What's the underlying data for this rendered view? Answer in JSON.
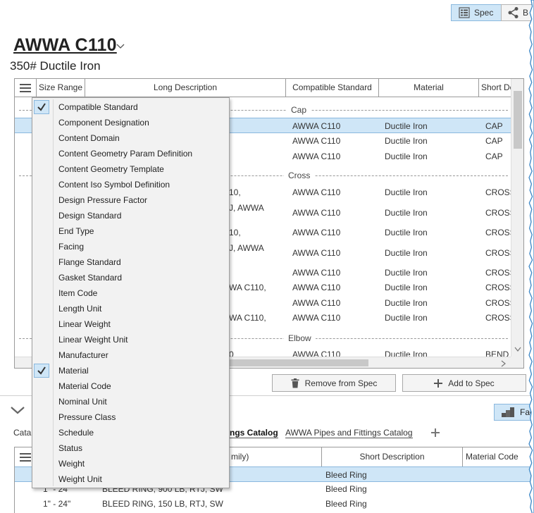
{
  "toolbar": {
    "spec_label": "Spec",
    "share_label": "B"
  },
  "spec": {
    "title": "AWWA C110",
    "subtitle": "350# Ductile Iron"
  },
  "grid": {
    "columns": [
      "Size Range",
      "Long Description",
      "Compatible Standard",
      "Material",
      "Short De"
    ],
    "groups": [
      "Cap",
      "Cross",
      "Elbow"
    ],
    "rows": [
      {
        "long": "",
        "standard": "AWWA C110",
        "material": "Ductile Iron",
        "short": "CAP"
      },
      {
        "long": "",
        "standard": "AWWA C110",
        "material": "Ductile Iron",
        "short": "CAP"
      },
      {
        "long": "",
        "standard": "AWWA C110",
        "material": "Ductile Iron",
        "short": "CAP"
      },
      {
        "long": "10,",
        "standard": "AWWA C110",
        "material": "Ductile Iron",
        "short": "CROSS"
      },
      {
        "long": "J, AWWA",
        "standard": "AWWA C110",
        "material": "Ductile Iron",
        "short": "CROSS"
      },
      {
        "long": "10,",
        "standard": "AWWA C110",
        "material": "Ductile Iron",
        "short": "CROSS"
      },
      {
        "long": "J, AWWA",
        "standard": "AWWA C110",
        "material": "Ductile Iron",
        "short": "CROSS"
      },
      {
        "long": "",
        "standard": "AWWA C110",
        "material": "Ductile Iron",
        "short": "CROSS"
      },
      {
        "long": "WA C110,",
        "standard": "AWWA C110",
        "material": "Ductile Iron",
        "short": "CROSS"
      },
      {
        "long": "",
        "standard": "AWWA C110",
        "material": "Ductile Iron",
        "short": "CROSS"
      },
      {
        "long": "WA C110,",
        "standard": "AWWA C110",
        "material": "Ductile Iron",
        "short": "CROSS"
      },
      {
        "long": "0",
        "standard": "AWWA C110",
        "material": "Ductile Iron",
        "short": "BEND"
      }
    ]
  },
  "column_menu": {
    "items": [
      {
        "label": "Compatible Standard",
        "checked": true
      },
      {
        "label": "Component Designation",
        "checked": false
      },
      {
        "label": "Content Domain",
        "checked": false
      },
      {
        "label": "Content Geometry Param Definition",
        "checked": false
      },
      {
        "label": "Content Geometry Template",
        "checked": false
      },
      {
        "label": "Content Iso Symbol Definition",
        "checked": false
      },
      {
        "label": "Design Pressure Factor",
        "checked": false
      },
      {
        "label": "Design Standard",
        "checked": false
      },
      {
        "label": "End Type",
        "checked": false
      },
      {
        "label": "Facing",
        "checked": false
      },
      {
        "label": "Flange Standard",
        "checked": false
      },
      {
        "label": "Gasket Standard",
        "checked": false
      },
      {
        "label": "Item Code",
        "checked": false
      },
      {
        "label": "Length Unit",
        "checked": false
      },
      {
        "label": "Linear Weight",
        "checked": false
      },
      {
        "label": "Linear Weight Unit",
        "checked": false
      },
      {
        "label": "Manufacturer",
        "checked": false
      },
      {
        "label": "Material",
        "checked": true
      },
      {
        "label": "Material Code",
        "checked": false
      },
      {
        "label": "Nominal Unit",
        "checked": false
      },
      {
        "label": "Pressure Class",
        "checked": false
      },
      {
        "label": "Schedule",
        "checked": false
      },
      {
        "label": "Status",
        "checked": false
      },
      {
        "label": "Weight",
        "checked": false
      },
      {
        "label": "Weight Unit",
        "checked": false
      }
    ]
  },
  "actions": {
    "remove_label": "Remove from Spec",
    "add_label": "Add to Spec"
  },
  "catalog": {
    "facets_label": "Fac",
    "tabs": [
      {
        "label": "Catal"
      },
      {
        "label": "ngs Catalog"
      },
      {
        "label": "AWWA Pipes and Fittings Catalog"
      }
    ],
    "columns": [
      "mily)",
      "Short Description",
      "Material Code"
    ],
    "rows": [
      {
        "size": "",
        "desc": "",
        "short": "Bleed Ring"
      },
      {
        "size": "1\" - 24\"",
        "desc": "BLEED RING, 900 LB, RTJ, SW",
        "short": "Bleed Ring"
      },
      {
        "size": "1\" - 24\"",
        "desc": "BLEED RING, 150 LB, RTJ, SW",
        "short": "Bleed Ring"
      }
    ]
  },
  "colors": {
    "selection": "#cfe6f7",
    "selection_border": "#8ab8de"
  }
}
